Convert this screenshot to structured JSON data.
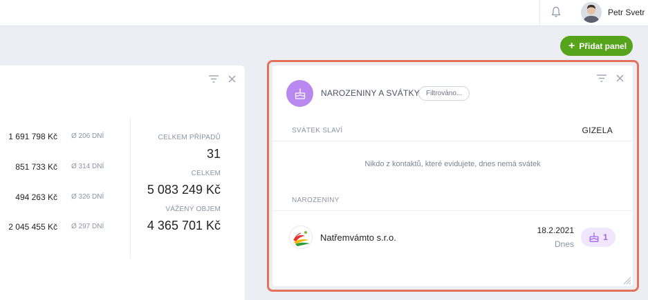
{
  "header": {
    "user_name": "Petr Svetr",
    "notification_icon": "bell-icon"
  },
  "toolbar": {
    "add_panel_label": "Přidat panel",
    "add_panel_color": "#56a41b"
  },
  "left_panel": {
    "rows": [
      {
        "amount": "1 691 798 Kč",
        "avg": "Ø 206 DNÍ"
      },
      {
        "amount": "851 733 Kč",
        "avg": "Ø 314 DNÍ"
      },
      {
        "amount": "494 263 Kč",
        "avg": "Ø 326 DNÍ"
      },
      {
        "amount": "2 045 455 Kč",
        "avg": "Ø 297 DNÍ"
      }
    ],
    "stats": [
      {
        "label": "CELKEM PŘÍPADŮ",
        "value": "31"
      },
      {
        "label": "CELKEM",
        "value": "5 083 249 Kč"
      },
      {
        "label": "VÁŽENÝ OBJEM",
        "value": "4 365 701 Kč"
      }
    ]
  },
  "right_panel": {
    "title": "NAROZENINY A SVÁTKY",
    "filter_chip": "Filtrováno...",
    "nameday_label": "SVÁTEK SLAVÍ",
    "nameday_name": "GIZELA",
    "nameday_empty": "Nikdo z kontaktů, které evidujete, dnes nemá svátek",
    "birthdays_label": "NAROZENINY",
    "birthdays": [
      {
        "name": "Natřemvámto s.r.o.",
        "date": "18.2.2021",
        "when": "Dnes",
        "count": "1"
      }
    ],
    "accent_color": "#b888ef",
    "highlight_color": "#e2725b"
  }
}
